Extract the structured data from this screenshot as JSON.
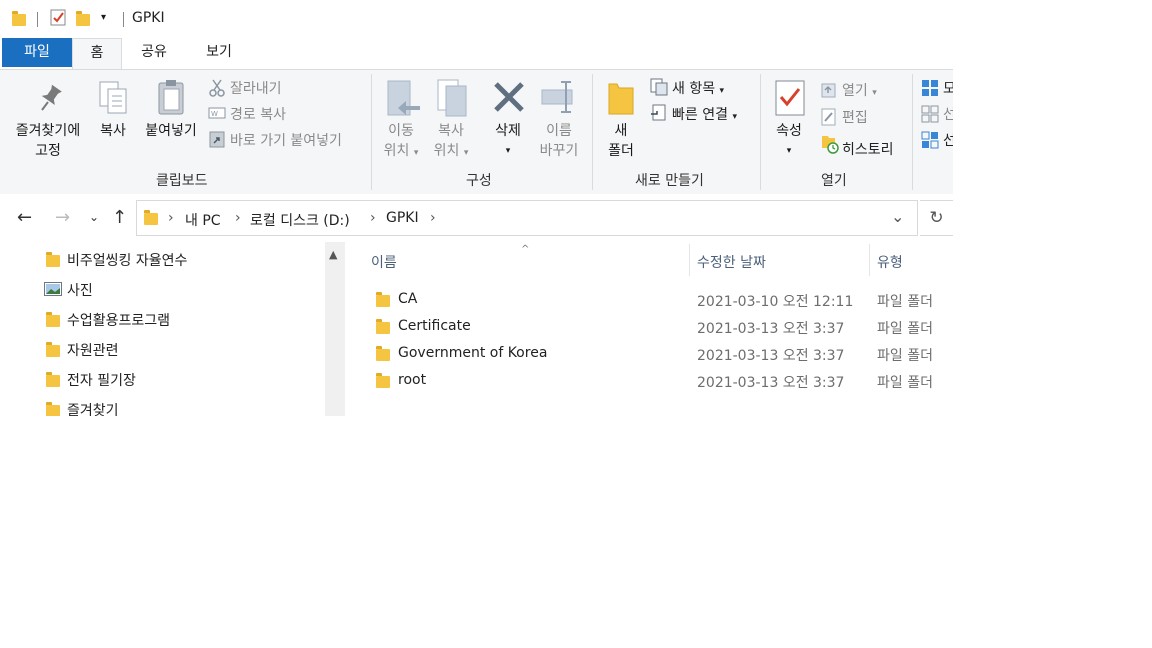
{
  "window": {
    "title": "GPKI"
  },
  "tabs": [
    {
      "label": "파일"
    },
    {
      "label": "홈"
    },
    {
      "label": "공유"
    },
    {
      "label": "보기"
    }
  ],
  "ribbon": {
    "clipboard": {
      "group_label": "클립보드",
      "pin_line1": "즐겨찾기에",
      "pin_line2": "고정",
      "copy": "복사",
      "paste": "붙여넣기",
      "cut": "잘라내기",
      "copy_path": "경로 복사",
      "paste_shortcut": "바로 가기 붙여넣기"
    },
    "organize": {
      "group_label": "구성",
      "move_line1": "이동",
      "move_line2": "위치",
      "copyto_line1": "복사",
      "copyto_line2": "위치",
      "delete": "삭제",
      "rename_line1": "이름",
      "rename_line2": "바꾸기"
    },
    "new": {
      "group_label": "새로 만들기",
      "newfolder_line1": "새",
      "newfolder_line2": "폴더",
      "new_item": "새 항목",
      "easy_access": "빠른 연결"
    },
    "open": {
      "group_label": "열기",
      "properties": "속성",
      "open": "열기",
      "edit": "편집",
      "history": "히스토리"
    },
    "select": {
      "item1": "모",
      "item2": "선",
      "item3": "선"
    }
  },
  "address": {
    "crumbs": [
      "내 PC",
      "로컬 디스크 (D:)",
      "GPKI"
    ]
  },
  "navpane": {
    "items": [
      {
        "label": "비주얼씽킹 자율연수",
        "icon": "folder-icon"
      },
      {
        "label": "사진",
        "icon": "pictures-icon"
      },
      {
        "label": "수업활용프로그램",
        "icon": "folder-icon"
      },
      {
        "label": "자원관련",
        "icon": "folder-icon"
      },
      {
        "label": "전자 필기장",
        "icon": "folder-icon"
      },
      {
        "label": "즐겨찾기",
        "icon": "folder-icon"
      }
    ]
  },
  "filelist": {
    "columns": {
      "name": "이름",
      "date": "수정한 날짜",
      "type": "유형"
    },
    "rows": [
      {
        "name": "CA",
        "date": "2021-03-10 오전 12:11",
        "type": "파일 폴더"
      },
      {
        "name": "Certificate",
        "date": "2021-03-13 오전 3:37",
        "type": "파일 폴더"
      },
      {
        "name": "Government of Korea",
        "date": "2021-03-13 오전 3:37",
        "type": "파일 폴더"
      },
      {
        "name": "root",
        "date": "2021-03-13 오전 3:37",
        "type": "파일 폴더"
      }
    ]
  },
  "colors": {
    "file_tab": "#1a6fc0",
    "ribbon_bg": "#f5f6f7",
    "folder": "#f5c542"
  }
}
